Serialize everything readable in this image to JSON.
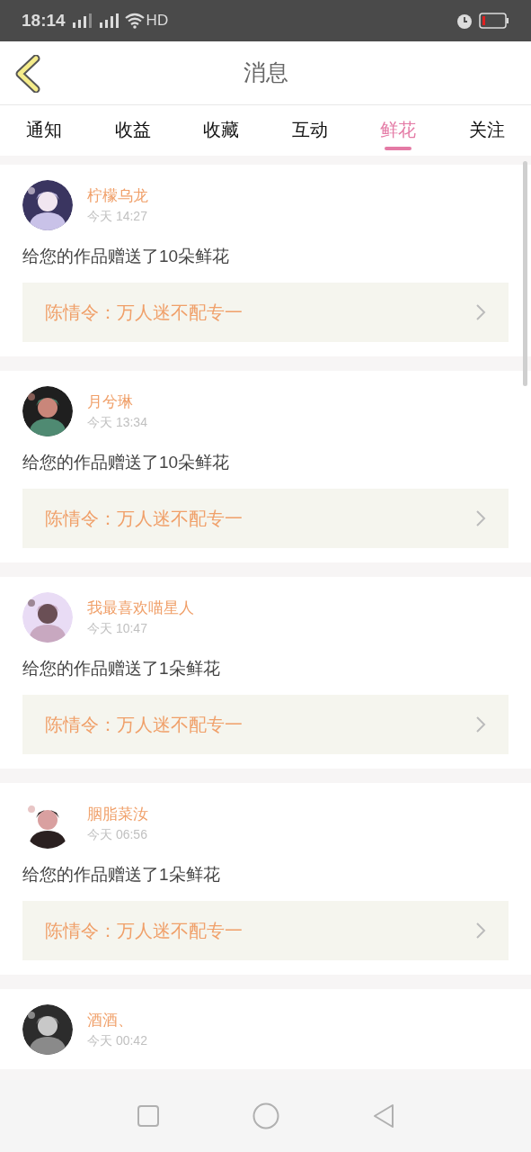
{
  "status_bar": {
    "time": "18:14",
    "network": "HD"
  },
  "header": {
    "title": "消息"
  },
  "tabs": [
    {
      "label": "通知",
      "selected": false
    },
    {
      "label": "收益",
      "selected": false
    },
    {
      "label": "收藏",
      "selected": false
    },
    {
      "label": "互动",
      "selected": false
    },
    {
      "label": "鲜花",
      "selected": true
    },
    {
      "label": "关注",
      "selected": false
    }
  ],
  "messages": [
    {
      "name": "柠檬乌龙",
      "time": "今天 14:27",
      "text": "给您的作品赠送了10朵鲜花",
      "work": "陈情令：万人迷不配专一"
    },
    {
      "name": "月兮琳",
      "time": "今天 13:34",
      "text": "给您的作品赠送了10朵鲜花",
      "work": "陈情令：万人迷不配专一"
    },
    {
      "name": "我最喜欢喵星人",
      "time": "今天 10:47",
      "text": "给您的作品赠送了1朵鲜花",
      "work": "陈情令：万人迷不配专一"
    },
    {
      "name": "胭脂菜汝",
      "time": "今天 06:56",
      "text": "给您的作品赠送了1朵鲜花",
      "work": "陈情令：万人迷不配专一"
    },
    {
      "name": "酒酒、",
      "time": "今天 00:42"
    }
  ]
}
